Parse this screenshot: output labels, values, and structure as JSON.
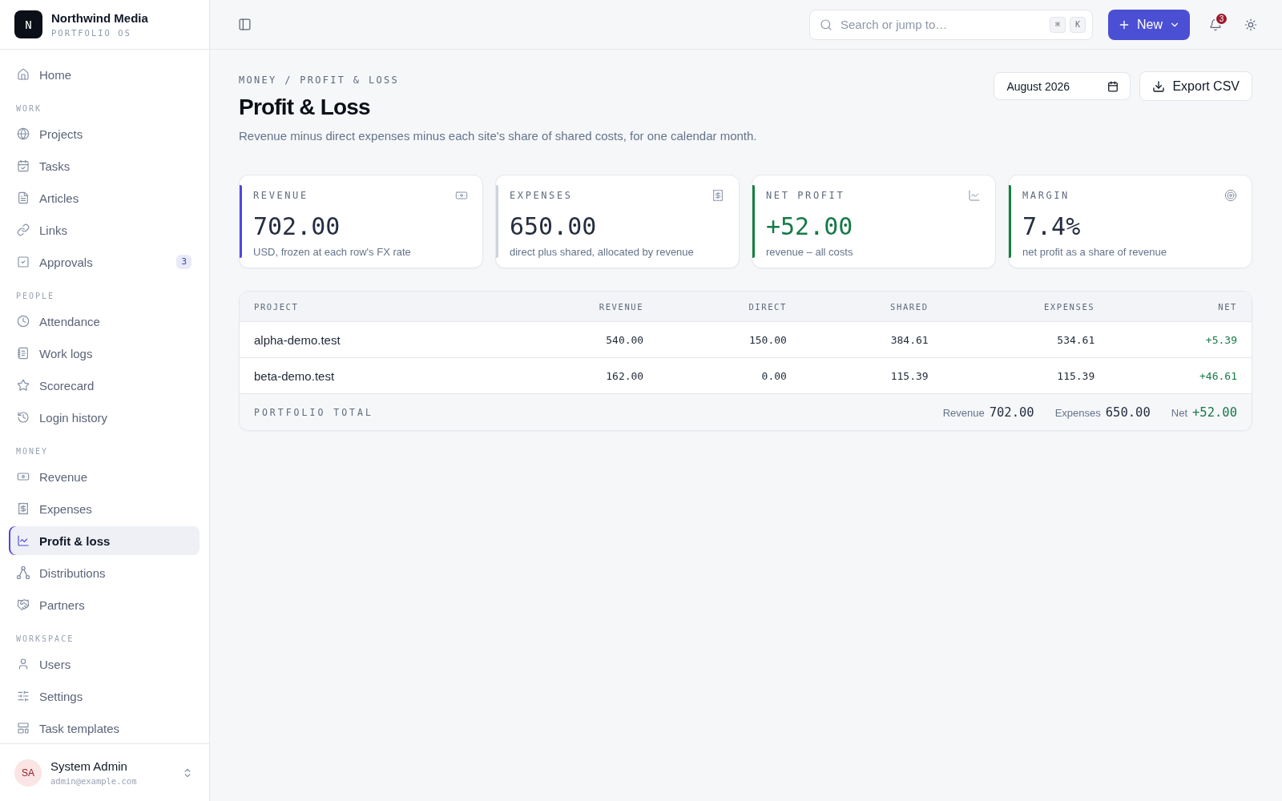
{
  "sidebar": {
    "brand": {
      "logo": "N",
      "name": "Northwind Media",
      "tagline": "PORTFOLIO OS"
    },
    "sections": [
      {
        "items": [
          {
            "label": "Home",
            "selected": false
          }
        ]
      },
      {
        "title": "WORK",
        "items": [
          {
            "label": "Projects",
            "selected": false
          },
          {
            "label": "Tasks",
            "selected": false
          },
          {
            "label": "Articles",
            "selected": false
          },
          {
            "label": "Links",
            "selected": false
          },
          {
            "label": "Approvals",
            "selected": false,
            "badge": "3"
          }
        ]
      },
      {
        "title": "PEOPLE",
        "items": [
          {
            "label": "Attendance",
            "selected": false
          },
          {
            "label": "Work logs",
            "selected": false
          },
          {
            "label": "Scorecard",
            "selected": false
          },
          {
            "label": "Login history",
            "selected": false
          }
        ]
      },
      {
        "title": "MONEY",
        "items": [
          {
            "label": "Revenue",
            "selected": false
          },
          {
            "label": "Expenses",
            "selected": false
          },
          {
            "label": "Profit & loss",
            "selected": true
          },
          {
            "label": "Distributions",
            "selected": false
          },
          {
            "label": "Partners",
            "selected": false
          }
        ]
      },
      {
        "title": "WORKSPACE",
        "items": [
          {
            "label": "Users",
            "selected": false
          },
          {
            "label": "Settings",
            "selected": false
          },
          {
            "label": "Task templates",
            "selected": false
          }
        ]
      }
    ],
    "user": {
      "initials": "SA",
      "name": "System Admin",
      "email": "admin@example.com"
    }
  },
  "topbar": {
    "search": {
      "placeholder": "Search or jump to…",
      "keys": [
        "⌘",
        "K"
      ]
    },
    "new_button": "New",
    "notifications": {
      "badge": "3"
    }
  },
  "page": {
    "breadcrumb": "MONEY / PROFIT & LOSS",
    "title": "Profit & Loss",
    "subtitle": "Revenue minus direct expenses minus each site's share of shared costs, for one calendar month.",
    "month": "August 2026",
    "export_button": "Export CSV",
    "cards": [
      {
        "label": "REVENUE",
        "value": "702.00",
        "note": "USD, frozen at each row's FX rate",
        "color": "#4f46e5",
        "positive": false
      },
      {
        "label": "EXPENSES",
        "value": "650.00",
        "note": "direct plus shared, allocated by revenue",
        "color": "#cfd4dc",
        "positive": false
      },
      {
        "label": "NET PROFIT",
        "value": "+52.00",
        "note": "revenue – all costs",
        "color": "#15803d",
        "positive": true
      },
      {
        "label": "MARGIN",
        "value": "7.4%",
        "note": "net profit as a share of revenue",
        "color": "#15803d",
        "positive": false
      }
    ],
    "table": {
      "columns": [
        "PROJECT",
        "REVENUE",
        "DIRECT",
        "SHARED",
        "EXPENSES",
        "NET"
      ],
      "rows": [
        {
          "project": "alpha-demo.test",
          "revenue": "540.00",
          "direct": "150.00",
          "shared": "384.61",
          "expenses": "534.61",
          "net": "+5.39",
          "net_positive": true
        },
        {
          "project": "beta-demo.test",
          "revenue": "162.00",
          "direct": "0.00",
          "shared": "115.39",
          "expenses": "115.39",
          "net": "+46.61",
          "net_positive": true
        }
      ],
      "footer": {
        "label": "PORTFOLIO TOTAL",
        "totals": [
          {
            "label": "Revenue",
            "value": "702.00",
            "positive": false
          },
          {
            "label": "Expenses",
            "value": "650.00",
            "positive": false
          },
          {
            "label": "Net",
            "value": "+52.00",
            "positive": true
          }
        ]
      }
    }
  }
}
